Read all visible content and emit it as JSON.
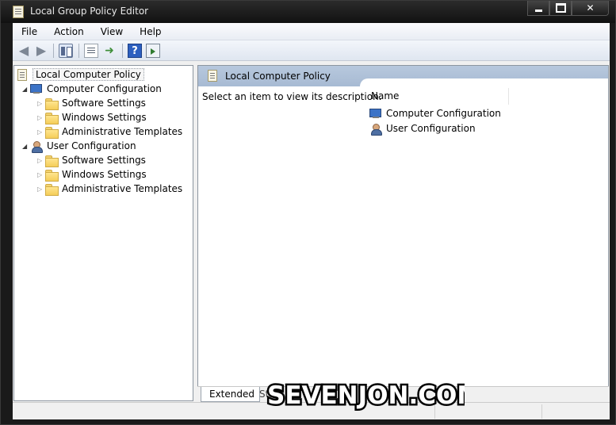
{
  "window": {
    "title": "Local Group Policy Editor"
  },
  "menubar": {
    "items": [
      "File",
      "Action",
      "View",
      "Help"
    ]
  },
  "tree": {
    "root": "Local Computer Policy",
    "nodes": [
      {
        "label": "Computer Configuration",
        "children": [
          "Software Settings",
          "Windows Settings",
          "Administrative Templates"
        ]
      },
      {
        "label": "User Configuration",
        "children": [
          "Software Settings",
          "Windows Settings",
          "Administrative Templates"
        ]
      }
    ]
  },
  "details": {
    "header_title": "Local Computer Policy",
    "description": "Select an item to view its description.",
    "column": "Name",
    "items": [
      "Computer Configuration",
      "User Configuration"
    ]
  },
  "tabs": {
    "extended": "Extended",
    "standard": "St"
  },
  "watermark": {
    "text": "SEVENJON.COM"
  },
  "colors": {
    "titlebar": "#1a1a1a",
    "details_header": "#b7c8dd",
    "folder": "#f5cd59"
  }
}
